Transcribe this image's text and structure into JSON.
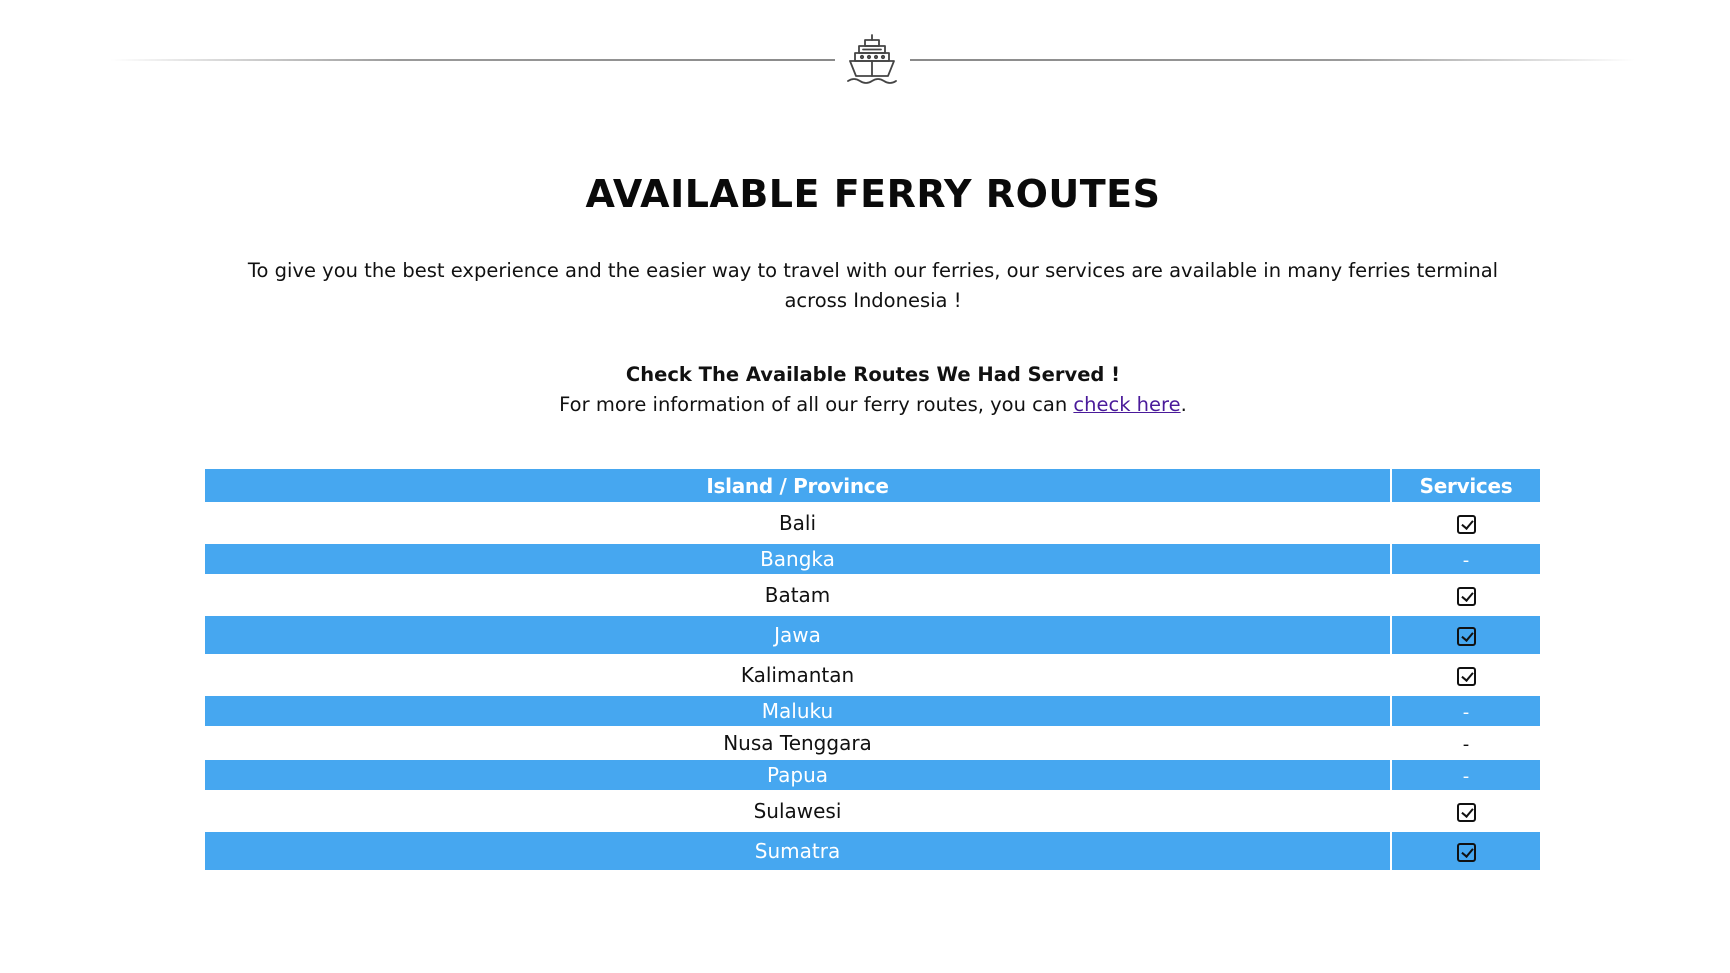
{
  "header": {
    "icon": "ship-icon"
  },
  "title": "AVAILABLE FERRY ROUTES",
  "intro": "To give you the best experience and the easier way to travel with our ferries, our services are available in many ferries terminal across Indonesia !",
  "check_heading": "Check The Available Routes We Had Served !",
  "more_info": {
    "prefix": "For more information of all our ferry routes, you can ",
    "link_text": "check here",
    "suffix": "."
  },
  "table": {
    "columns": [
      "Island / Province",
      "Services"
    ],
    "rows": [
      {
        "island": "Bali",
        "service": "check"
      },
      {
        "island": "Bangka",
        "service": "-"
      },
      {
        "island": "Batam",
        "service": "check"
      },
      {
        "island": "Jawa",
        "service": "check"
      },
      {
        "island": "Kalimantan",
        "service": "check"
      },
      {
        "island": "Maluku",
        "service": "-"
      },
      {
        "island": "Nusa Tenggara",
        "service": "-"
      },
      {
        "island": "Papua",
        "service": "-"
      },
      {
        "island": "Sulawesi",
        "service": "check"
      },
      {
        "island": "Sumatra",
        "service": "check"
      }
    ]
  },
  "colors": {
    "accent": "#46a7f0",
    "link": "#4a1a9a"
  }
}
